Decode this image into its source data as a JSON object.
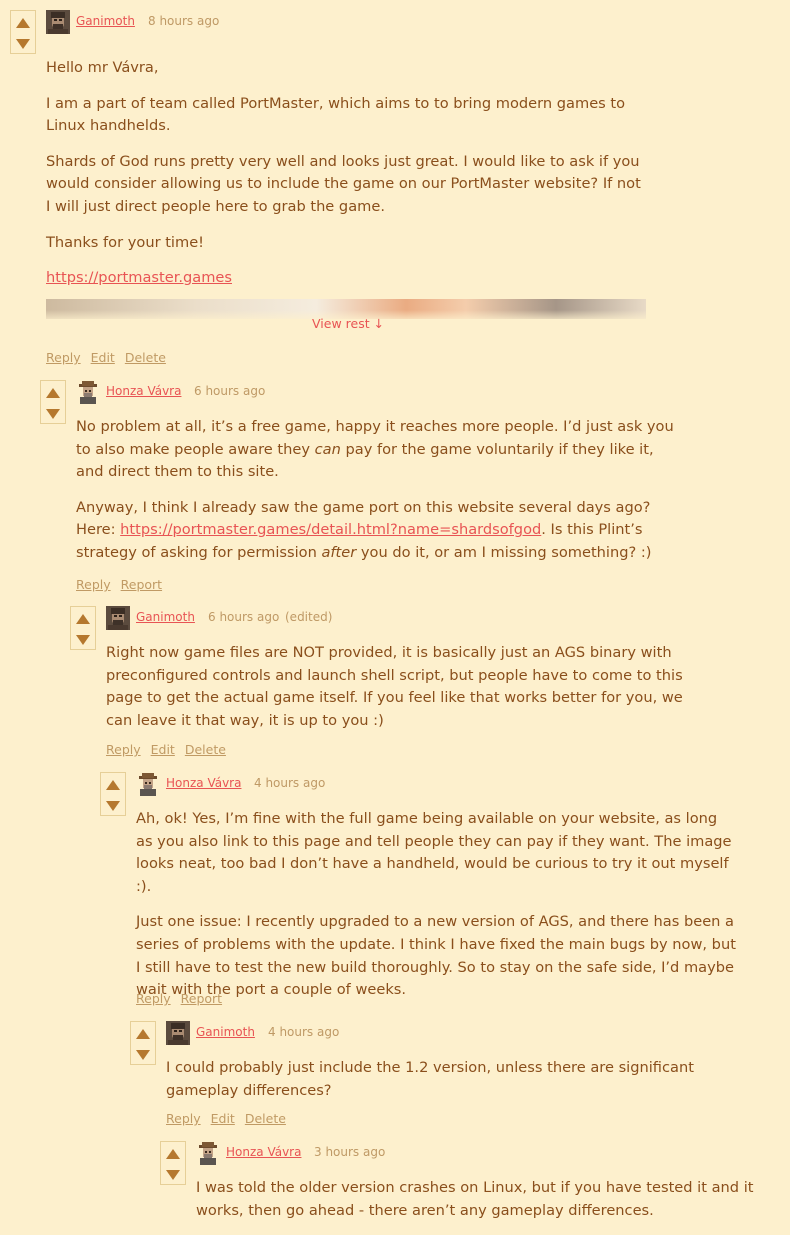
{
  "colors": {
    "background": "#fdf0cd",
    "text": "#8a4f1c",
    "link": "#e85454",
    "muted": "#bf9965",
    "vote_arrow": "#b5782e"
  },
  "comments": [
    {
      "author": "Ganimoth",
      "avatar": "ganimoth-avatar",
      "time": "8 hours ago",
      "paragraphs": [
        "Hello mr Vávra,",
        "I am a part of team called PortMaster, which aims to to bring modern games to Linux handhelds.",
        "Shards of God runs pretty very well and looks just great. I would like to ask if you would consider allowing us to include the game on our PortMaster website? If not I will just direct people here to grab the game.",
        "Thanks for your time!"
      ],
      "link": "https://portmaster.games",
      "view_rest": "View rest ↓",
      "actions": [
        "Reply",
        "Edit",
        "Delete"
      ]
    },
    {
      "author": "Honza Vávra",
      "avatar": "honza-avatar",
      "time": "6 hours ago",
      "p1_a": "No problem at all, it’s a free game, happy it reaches more people. I’d just ask you to also make people aware they ",
      "p1_em": "can",
      "p1_b": " pay for the game voluntarily if they like it, and direct them to this site.",
      "p2_a": "Anyway, I think I already saw the game port on this website several days ago? Here: ",
      "p2_link": "https://portmaster.games/detail.html?name=shardsofgod",
      "p2_b": ". Is this Plint’s strategy of asking for permission ",
      "p2_em": "after",
      "p2_c": " you do it, or am I missing something? :)",
      "actions": [
        "Reply",
        "Report"
      ]
    },
    {
      "author": "Ganimoth",
      "avatar": "ganimoth-avatar",
      "time": "6 hours ago",
      "edited": "(edited)",
      "paragraphs": [
        "Right now game files are NOT provided, it is basically just an AGS binary with preconfigured controls and launch shell script, but people have to come to this page to get the actual game itself. If you feel like that works better for you, we can leave it that way, it is up to you :)"
      ],
      "actions": [
        "Reply",
        "Edit",
        "Delete"
      ]
    },
    {
      "author": "Honza Vávra",
      "avatar": "honza-avatar",
      "time": "4 hours ago",
      "paragraphs": [
        "Ah, ok! Yes, I’m fine with the full game being available on your website, as long as you also link to this page and tell people they can pay if they want. The image looks neat, too bad I don’t have a handheld, would be curious to try it out myself :).",
        "Just one issue: I recently upgraded to a new version of AGS, and there has been a series of problems with the update. I think I have fixed the main bugs by now, but I still have to test the new build thoroughly. So to stay on the safe side, I’d maybe wait with the port a couple of weeks."
      ],
      "actions": [
        "Reply",
        "Report"
      ]
    },
    {
      "author": "Ganimoth",
      "avatar": "ganimoth-avatar",
      "time": "4 hours ago",
      "paragraphs": [
        "I could probably just include the 1.2 version, unless there are significant gameplay differences?"
      ],
      "actions": [
        "Reply",
        "Edit",
        "Delete"
      ]
    },
    {
      "author": "Honza Vávra",
      "avatar": "honza-avatar",
      "time": "3 hours ago",
      "paragraphs": [
        "I was told the older version crashes on Linux, but if you have tested it and it works, then go ahead - there aren’t any gameplay differences."
      ]
    }
  ]
}
